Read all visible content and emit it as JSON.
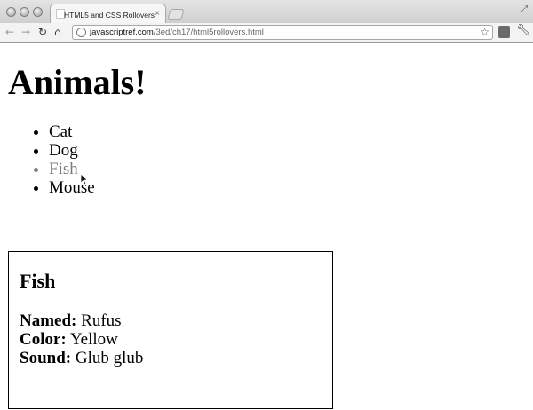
{
  "browser": {
    "tab_title": "HTML5 and CSS Rollovers",
    "tab_close": "×",
    "url_host": "javascriptref.com",
    "url_path": "/3ed/ch17/html5rollovers.html"
  },
  "page": {
    "heading": "Animals!",
    "animals": [
      {
        "label": "Cat",
        "hovered": false
      },
      {
        "label": "Dog",
        "hovered": false
      },
      {
        "label": "Fish",
        "hovered": true
      },
      {
        "label": "Mouse",
        "hovered": false
      }
    ],
    "info": {
      "title": "Fish",
      "named_label": "Named:",
      "named_value": "Rufus",
      "color_label": "Color:",
      "color_value": "Yellow",
      "sound_label": "Sound:",
      "sound_value": "Glub glub"
    }
  },
  "icons": {
    "back": "back-arrow-icon",
    "forward": "forward-arrow-icon",
    "reload": "reload-icon",
    "home": "home-icon",
    "star": "bookmark-star-icon",
    "wrench": "wrench-icon"
  },
  "colors": {
    "hover_text": "#7a7a7a",
    "text": "#000000"
  }
}
